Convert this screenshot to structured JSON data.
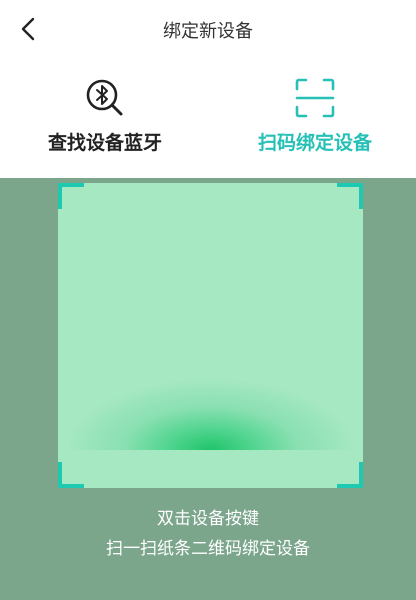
{
  "header": {
    "title": "绑定新设备",
    "back_icon": "chevron-left-icon"
  },
  "tabs": [
    {
      "label": "查找设备蓝牙",
      "icon": "bluetooth-search-icon",
      "active": false
    },
    {
      "label": "扫码绑定设备",
      "icon": "scan-frame-icon",
      "active": true
    }
  ],
  "scanner": {
    "hint_line1": "双击设备按键",
    "hint_line2": "扫一扫纸条二维码绑定设备"
  },
  "colors": {
    "accent": "#26c0b6",
    "overlay": "#7ba68c",
    "scan_box": "#a6e8c2",
    "scan_line": "#1fc46a"
  }
}
